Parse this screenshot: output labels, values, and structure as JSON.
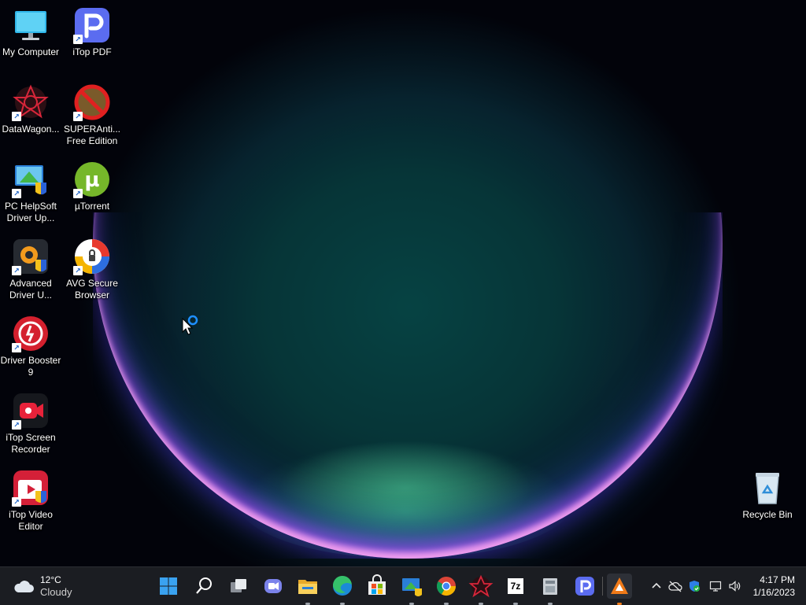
{
  "desktop": {
    "icons": [
      {
        "label": "My Computer",
        "icon": "computer-icon"
      },
      {
        "label": "iTop PDF",
        "icon": "itop-pdf-icon"
      },
      {
        "label": "DataWagon...",
        "icon": "datawagon-icon"
      },
      {
        "label": "SUPERAnti...\nFree Edition",
        "icon": "superantispyware-icon"
      },
      {
        "label": "PC HelpSoft\nDriver Up...",
        "icon": "pc-helpsoft-icon"
      },
      {
        "label": "µTorrent",
        "icon": "utorrent-icon"
      },
      {
        "label": "Advanced\nDriver U...",
        "icon": "advanced-driver-updater-icon"
      },
      {
        "label": "AVG Secure\nBrowser",
        "icon": "avg-secure-browser-icon"
      },
      {
        "label": "Driver Booster\n9",
        "icon": "driver-booster-icon"
      },
      {
        "label": "iTop Screen\nRecorder",
        "icon": "itop-screen-recorder-icon"
      },
      {
        "label": "iTop Video\nEditor",
        "icon": "itop-video-editor-icon"
      }
    ],
    "recycle_bin": {
      "label": "Recycle Bin",
      "icon": "recycle-bin-icon"
    }
  },
  "taskbar": {
    "weather": {
      "temp": "12°C",
      "condition": "Cloudy",
      "icon": "cloud-icon"
    },
    "apps": [
      {
        "name": "start",
        "icon": "windows-start-icon"
      },
      {
        "name": "search",
        "icon": "search-icon"
      },
      {
        "name": "task-view",
        "icon": "task-view-icon"
      },
      {
        "name": "teams-chat",
        "icon": "chat-icon"
      },
      {
        "name": "file-explorer",
        "icon": "folder-icon"
      },
      {
        "name": "edge",
        "icon": "edge-icon"
      },
      {
        "name": "store",
        "icon": "store-icon"
      },
      {
        "name": "pc-helpsoft",
        "icon": "pc-helpsoft-icon"
      },
      {
        "name": "chrome",
        "icon": "chrome-icon"
      },
      {
        "name": "datawagon",
        "icon": "datawagon-icon"
      },
      {
        "name": "7zip",
        "icon": "seven-zip-icon",
        "text": "7z"
      },
      {
        "name": "archive",
        "icon": "archive-icon"
      },
      {
        "name": "itop-pdf",
        "icon": "itop-pdf-icon"
      },
      {
        "name": "app-orange",
        "icon": "orange-app-icon"
      }
    ],
    "tray": {
      "icons": [
        "chevron-up-icon",
        "onedrive-icon",
        "security-icon",
        "network-icon",
        "volume-icon"
      ],
      "time": "4:17 PM",
      "date": "1/16/2023"
    }
  },
  "colors": {
    "taskbar_bg": "#1b1d22",
    "accent_blue": "#1a73e8"
  }
}
